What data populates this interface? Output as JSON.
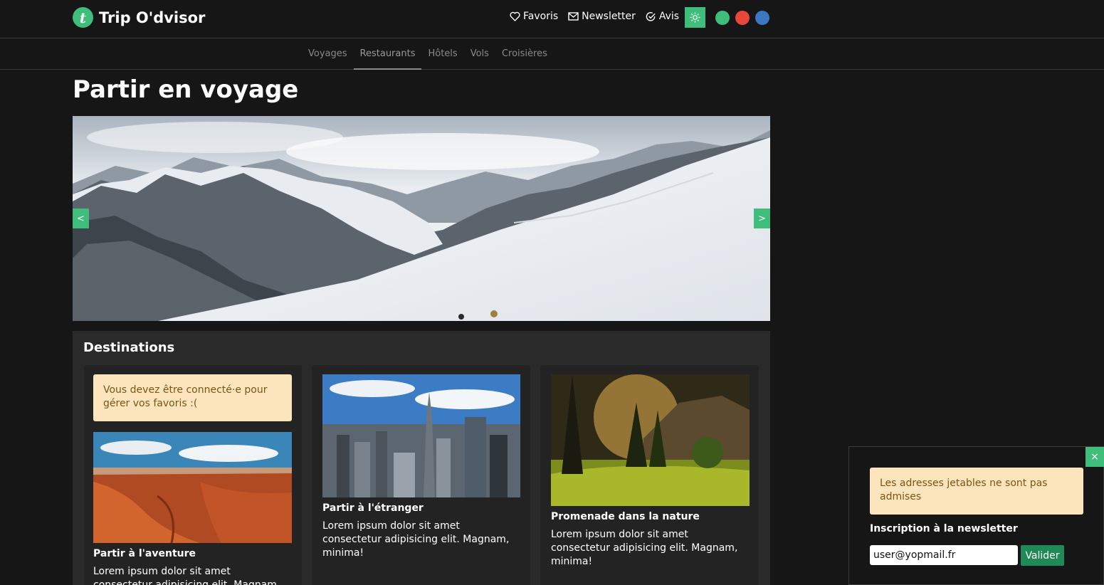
{
  "brand": {
    "logo_letter": "t",
    "name": "Trip O'dvisor"
  },
  "header": {
    "links": [
      {
        "label": "Favoris",
        "icon": "heart-icon"
      },
      {
        "label": "Newsletter",
        "icon": "envelope-icon"
      },
      {
        "label": "Avis",
        "icon": "check-circle-icon"
      }
    ],
    "theme_icon": "sun-icon",
    "color_dots": [
      "#3fbd7a",
      "#e8473a",
      "#3a78c2"
    ]
  },
  "subnav": {
    "tabs": [
      "Voyages",
      "Restaurants",
      "Hôtels",
      "Vols",
      "Croisières"
    ],
    "active_tab": "Restaurants"
  },
  "main": {
    "title": "Partir en voyage",
    "carousel": {
      "prev_label": "<",
      "next_label": ">"
    },
    "destinations": {
      "title": "Destinations",
      "favorites_warning": "Vous devez être connecté·e pour gérer vos favoris :(",
      "cards": [
        {
          "title": "Partir à l'aventure",
          "text": "Lorem ipsum dolor sit amet consectetur adipisicing elit. Magnam, minima!"
        },
        {
          "title": "Partir à l'étranger",
          "text": "Lorem ipsum dolor sit amet consectetur adipisicing elit. Magnam, minima!"
        },
        {
          "title": "Promenade dans la nature",
          "text": "Lorem ipsum dolor sit amet consectetur adipisicing elit. Magnam, minima!"
        }
      ]
    }
  },
  "newsletter_popup": {
    "close_label": "×",
    "warning": "Les adresses jetables ne sont pas admises",
    "label": "Inscription à la newsletter",
    "email_value": "user@yopmail.fr",
    "submit_label": "Valider"
  },
  "colors": {
    "accent": "#3fbd7a",
    "background": "#161616",
    "panel": "#2a2a2a",
    "warning_bg": "#fce5bd"
  }
}
